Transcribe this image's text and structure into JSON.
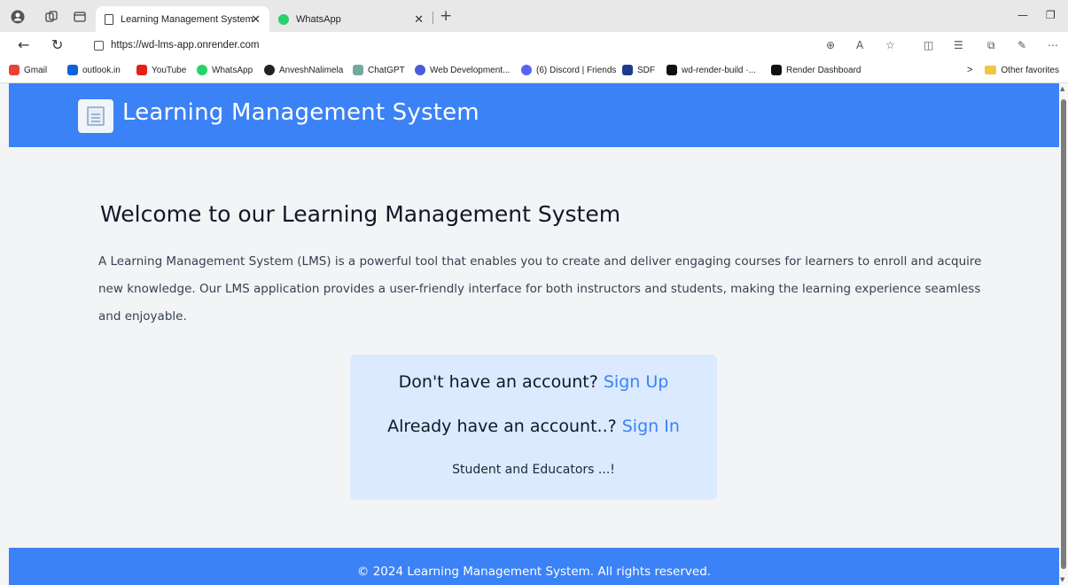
{
  "browser": {
    "tabs": [
      {
        "label": "Learning Management System",
        "active": true
      },
      {
        "label": "WhatsApp",
        "active": false
      }
    ],
    "url": "https://wd-lms-app.onrender.com",
    "bookmarks": [
      {
        "label": "Gmail",
        "color": "#ea4335"
      },
      {
        "label": "outlook.in",
        "color": "#0a64d6"
      },
      {
        "label": "YouTube",
        "color": "#e62117"
      },
      {
        "label": "WhatsApp",
        "color": "#25d366"
      },
      {
        "label": "AnveshNalimela",
        "color": "#222222"
      },
      {
        "label": "ChatGPT",
        "color": "#74aa9c"
      },
      {
        "label": "Web Development...",
        "color": "#4b5bd8"
      },
      {
        "label": "(6) Discord | Friends",
        "color": "#5865f2"
      },
      {
        "label": "SDF",
        "color": "#1e3a8a"
      },
      {
        "label": "wd-render-build ·...",
        "color": "#111111"
      },
      {
        "label": "Render Dashboard",
        "color": "#111111"
      }
    ],
    "other_favorites": "Other favorites"
  },
  "header": {
    "title": "Learning Management System"
  },
  "main": {
    "welcome_title": "Welcome to our Learning Management System",
    "intro": "A Learning Management System (LMS) is a powerful tool that enables you to create and deliver engaging courses for learners to enroll and acquire new knowledge. Our LMS application provides a user-friendly interface for both instructors and students, making the learning experience seamless and enjoyable."
  },
  "auth": {
    "signup_prompt": "Don't have an account?",
    "signup_link": "Sign Up",
    "signin_prompt": "Already have an account..?",
    "signin_link": "Sign In",
    "note": "Student and Educators ...!"
  },
  "footer": {
    "text": "© 2024 Learning Management System. All rights reserved."
  },
  "colors": {
    "brand": "#3b82f6",
    "card": "#dbeafe",
    "page_bg": "#f3f4f6"
  }
}
